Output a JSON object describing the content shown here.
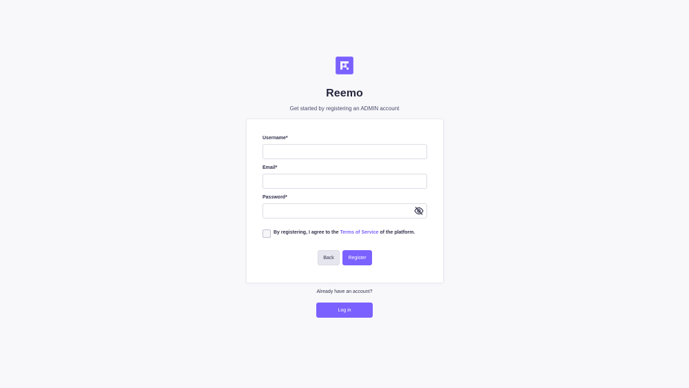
{
  "app": {
    "title": "Reemo",
    "subtitle": "Get started by registering an ADMIN account",
    "logo_icon": "reemo-logo-icon"
  },
  "form": {
    "username": {
      "label": "Username*",
      "value": "",
      "placeholder": ""
    },
    "email": {
      "label": "Email*",
      "value": "",
      "placeholder": ""
    },
    "password": {
      "label": "Password*",
      "value": "",
      "placeholder": "",
      "toggle_icon": "eye-off-icon"
    },
    "terms": {
      "checked": false,
      "prefix": "By registering, I agree to the ",
      "link_text": "Terms of Service",
      "suffix": " of the platform."
    },
    "back_label": "Back",
    "register_label": "Register"
  },
  "login": {
    "prompt": "Already have an account?",
    "button_label": "Log in"
  },
  "colors": {
    "accent": "#7b61ff",
    "background": "#f8f8fb",
    "card": "#ffffff",
    "text": "#32324d"
  }
}
